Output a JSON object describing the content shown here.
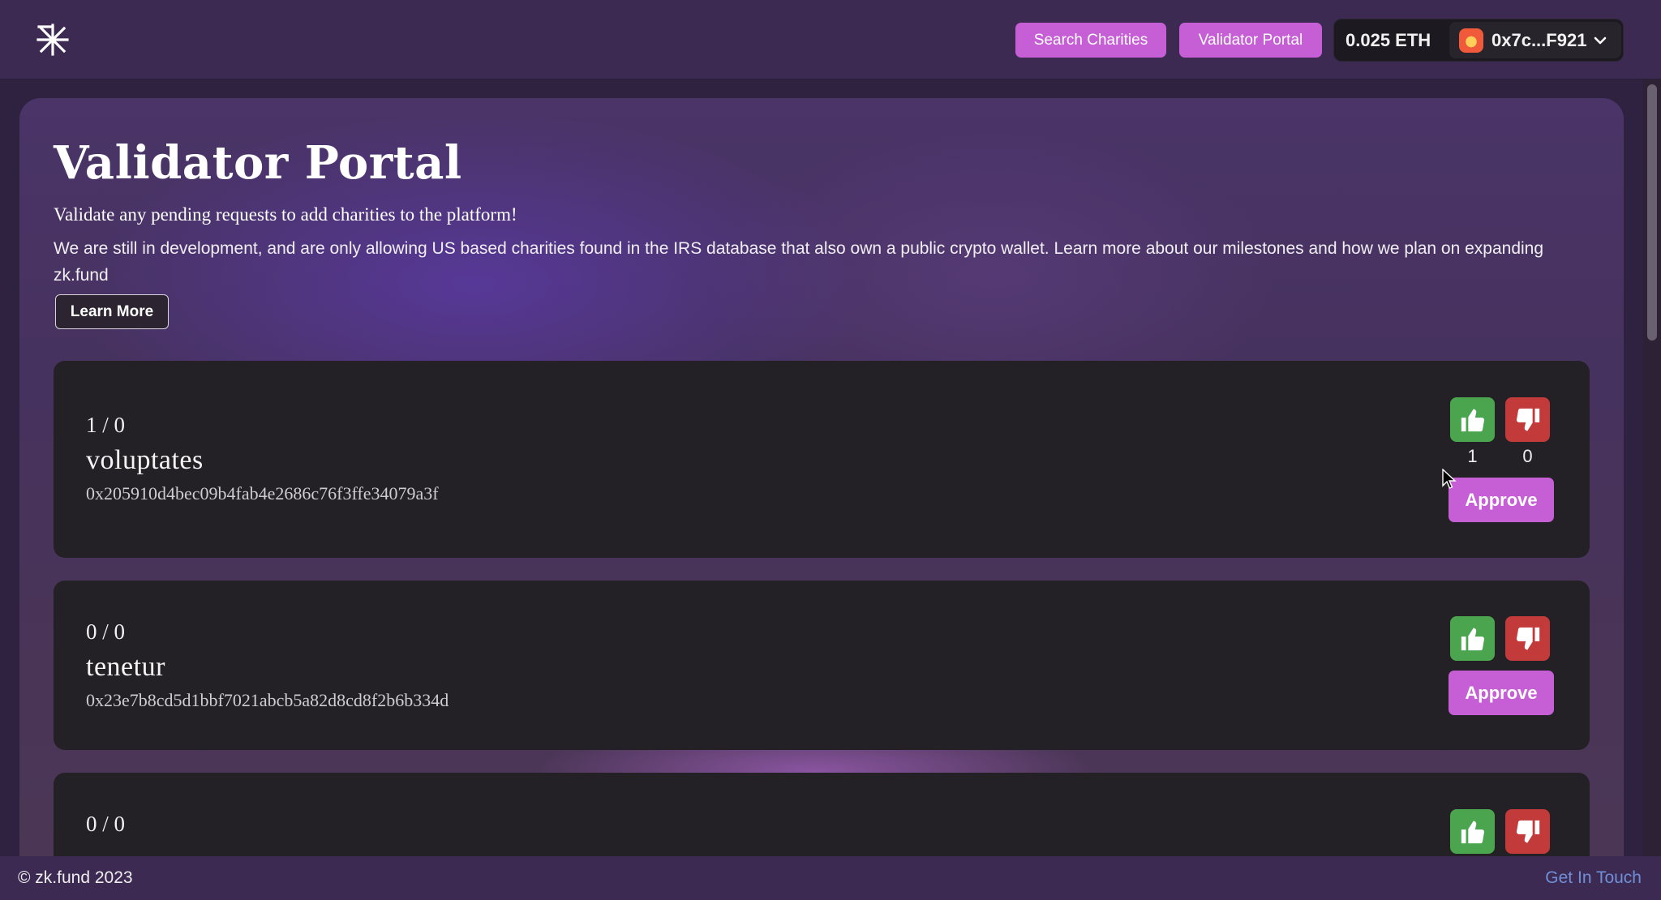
{
  "header": {
    "logo_icon": "zk-asterisk-logo-icon",
    "nav": {
      "search_label": "Search Charities",
      "validator_label": "Validator Portal"
    },
    "wallet": {
      "balance": "0.025 ETH",
      "address": "0x7c...F921",
      "chevron_icon": "chevron-down-icon"
    }
  },
  "main": {
    "title": "Validator Portal",
    "subtitle": "Validate any pending requests to add charities to the platform!",
    "description": "We are still in development, and are only allowing US based charities found in the IRS database that also own a public crypto wallet. Learn more about our milestones and how we plan on expanding zk.fund",
    "learn_more_label": "Learn More"
  },
  "requests": [
    {
      "score": "1 / 0",
      "name": "voluptates",
      "address": "0x205910d4bec09b4fab4e2686c76f3ffe34079a3f",
      "upvotes": "1",
      "downvotes": "0",
      "approve_label": "Approve"
    },
    {
      "score": "0 / 0",
      "name": "tenetur",
      "address": "0x23e7b8cd5d1bbf7021abcb5a82d8cd8f2b6b334d",
      "upvotes": "",
      "downvotes": "",
      "approve_label": "Approve"
    },
    {
      "score": "0 / 0",
      "name": "",
      "address": "",
      "upvotes": "",
      "downvotes": "",
      "approve_label": ""
    }
  ],
  "icons": {
    "upvote": "thumbs-up-icon",
    "downvote": "thumbs-down-icon"
  },
  "colors": {
    "accent": "#c65fd6",
    "upvote": "#4aa54e",
    "downvote": "#c23a3a",
    "link": "#6f8fd6"
  },
  "footer": {
    "copyright": "© zk.fund 2023",
    "contact_label": "Get In Touch"
  }
}
